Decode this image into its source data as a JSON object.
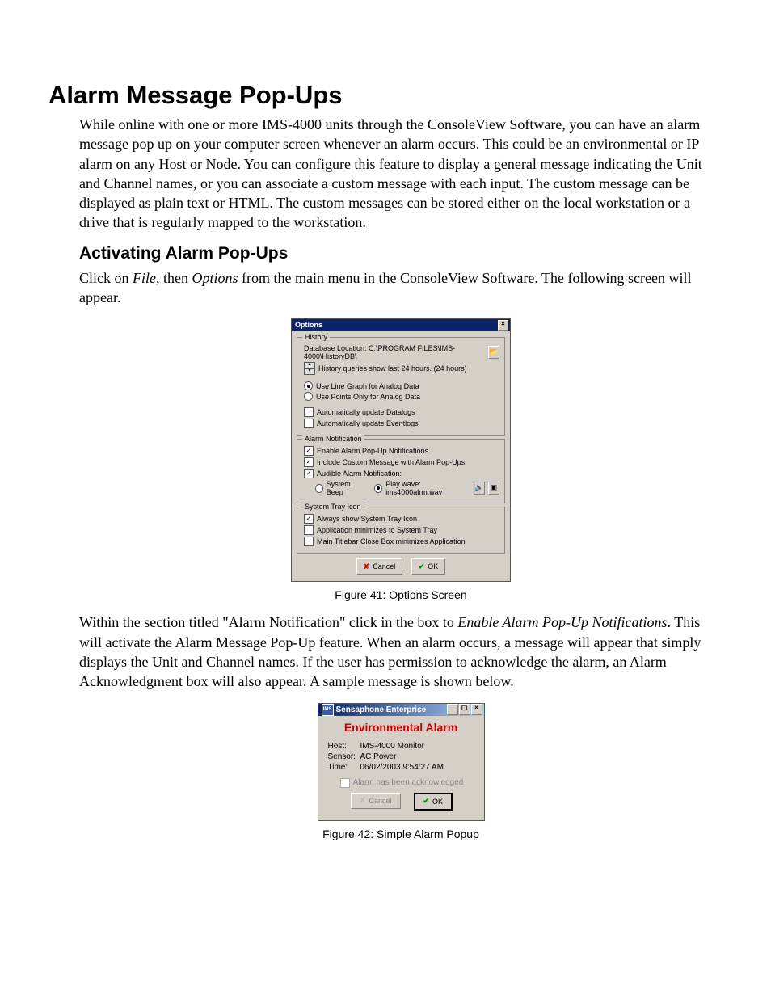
{
  "heading": "Alarm Message Pop-Ups",
  "intro": "While online with one or more IMS-4000 units through the ConsoleView Software, you can have an alarm message pop up on your computer screen whenever an alarm occurs. This could be an environmental or IP alarm on any Host or Node. You can configure this feature to display a general message indicating the Unit and Channel names, or you can associate a custom message with each input. The custom message can be displayed as plain text or HTML. The custom messages can be stored either on the local workstation or a drive that is regularly mapped to the workstation.",
  "subheading1": "Activating Alarm Pop-Ups",
  "para2_a": "Click on ",
  "para2_i1": "File",
  "para2_b": ", then ",
  "para2_i2": "Options",
  "para2_c": " from the main menu in the ConsoleView Software. The following screen will appear.",
  "fig41_caption": "Figure 41: Options Screen",
  "para3_a": "Within the section titled \"Alarm Notification\" click in the box to ",
  "para3_i1": "Enable Alarm Pop-Up Notifications",
  "para3_b": ".  This will activate the Alarm Message Pop-Up feature. When an alarm occurs, a message will appear that simply displays the Unit and Channel names.  If the user has permission to acknowledge the alarm, an Alarm Acknowledgment box will also appear. A sample message is shown below.",
  "fig42_caption": "Figure 42: Simple Alarm Popup",
  "options": {
    "title": "Options",
    "history": {
      "legend": "History",
      "db_label": "Database Location: C:\\PROGRAM FILES\\IMS-4000\\HistoryDB\\",
      "queries_label": "History queries show last 24 hours. (24 hours)",
      "line_graph": "Use Line Graph for Analog Data",
      "points_only": "Use Points Only for Analog Data",
      "auto_datalogs": "Automatically update Datalogs",
      "auto_eventlogs": "Automatically update Eventlogs"
    },
    "alarm": {
      "legend": "Alarm Notification",
      "enable_popup": "Enable Alarm Pop-Up Notifications",
      "include_custom": "Include Custom Message with Alarm Pop-Ups",
      "audible": "Audible Alarm Notification:",
      "system_beep": "System Beep",
      "play_wave": "Play wave: ims4000alrm.wav"
    },
    "tray": {
      "legend": "System Tray Icon",
      "always_show": "Always show System Tray Icon",
      "minimize_tray": "Application minimizes to System Tray",
      "close_minimize": "Main Titlebar Close Box minimizes Application"
    },
    "cancel": "Cancel",
    "ok": "OK"
  },
  "popup": {
    "title": "Sensaphone Enterprise",
    "env_title": "Environmental Alarm",
    "host_label": "Host:",
    "host_value": "IMS-4000 Monitor",
    "sensor_label": "Sensor:",
    "sensor_value": "AC Power",
    "time_label": "Time:",
    "time_value": "06/02/2003 9:54:27 AM",
    "ack_text": "Alarm has been acknowledged",
    "cancel": "Cancel",
    "ok": "OK"
  }
}
